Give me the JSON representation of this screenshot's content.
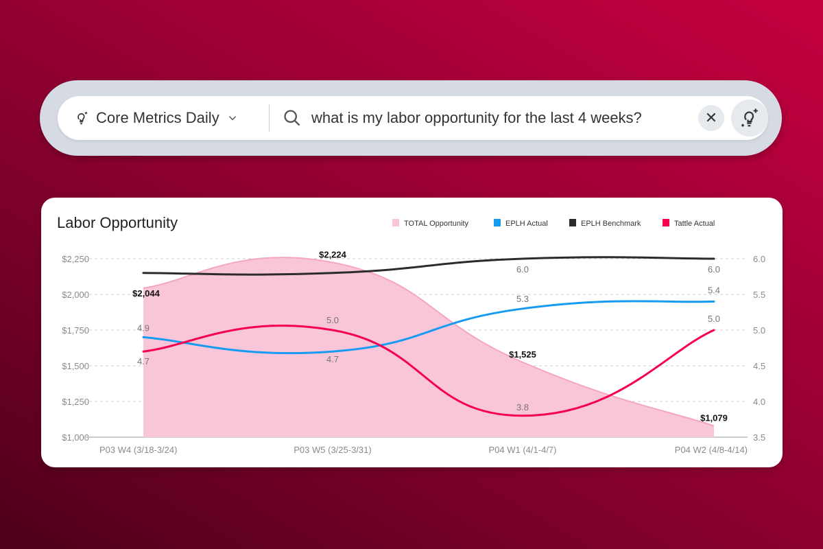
{
  "search_bar": {
    "source_label": "Core Metrics Daily",
    "query": "what is my labor opportunity for the last 4 weeks?",
    "icons": {
      "source": "lightbulb-sparkle-icon",
      "dropdown": "chevron-down-icon",
      "search": "search-icon",
      "clear": "close-icon",
      "assistant": "lightbulb-sparkle-icon"
    }
  },
  "chart_data": {
    "type": "line",
    "title": "Labor Opportunity",
    "categories": [
      "P03 W4 (3/18-3/24)",
      "P03 W5 (3/25-3/31)",
      "P04 W1 (4/1-4/7)",
      "P04 W2 (4/8-4/14)"
    ],
    "left_axis": {
      "ylim": [
        1000,
        2250
      ],
      "ticks": [
        "$1,000",
        "$1,250",
        "$1,500",
        "$1,750",
        "$2,000",
        "$2,250"
      ],
      "tick_values": [
        1000,
        1250,
        1500,
        1750,
        2000,
        2250
      ]
    },
    "right_axis": {
      "ylim": [
        3.5,
        6.0
      ],
      "ticks": [
        "3.5",
        "4.0",
        "4.5",
        "5.0",
        "5.5",
        "6.0"
      ],
      "tick_values": [
        3.5,
        4.0,
        4.5,
        5.0,
        5.5,
        6.0
      ]
    },
    "grid": true,
    "legend_position": "top-right",
    "series": [
      {
        "name": "TOTAL Opportunity",
        "type": "area",
        "axis": "left",
        "color": "#f9c5d8",
        "values": [
          2044,
          2224,
          1525,
          1079
        ],
        "labels": [
          "$2,044",
          "$2,224",
          "$1,525",
          "$1,079"
        ]
      },
      {
        "name": "EPLH Actual",
        "type": "line",
        "axis": "right",
        "color": "#159cf2",
        "values": [
          4.9,
          4.7,
          5.3,
          5.4
        ],
        "labels": [
          "4.9",
          "4.7",
          "5.3",
          "5.4"
        ]
      },
      {
        "name": "EPLH Benchmark",
        "type": "line",
        "axis": "right",
        "color": "#2b2b2b",
        "values": [
          5.8,
          5.8,
          6.0,
          6.0
        ],
        "labels": [
          null,
          null,
          "6.0",
          "6.0"
        ]
      },
      {
        "name": "Tattle Actual",
        "type": "line",
        "axis": "right",
        "color": "#f5004f",
        "values": [
          4.7,
          5.0,
          3.8,
          5.0
        ],
        "labels": [
          "4.7",
          "5.0",
          "3.8",
          "5.0"
        ]
      }
    ]
  }
}
